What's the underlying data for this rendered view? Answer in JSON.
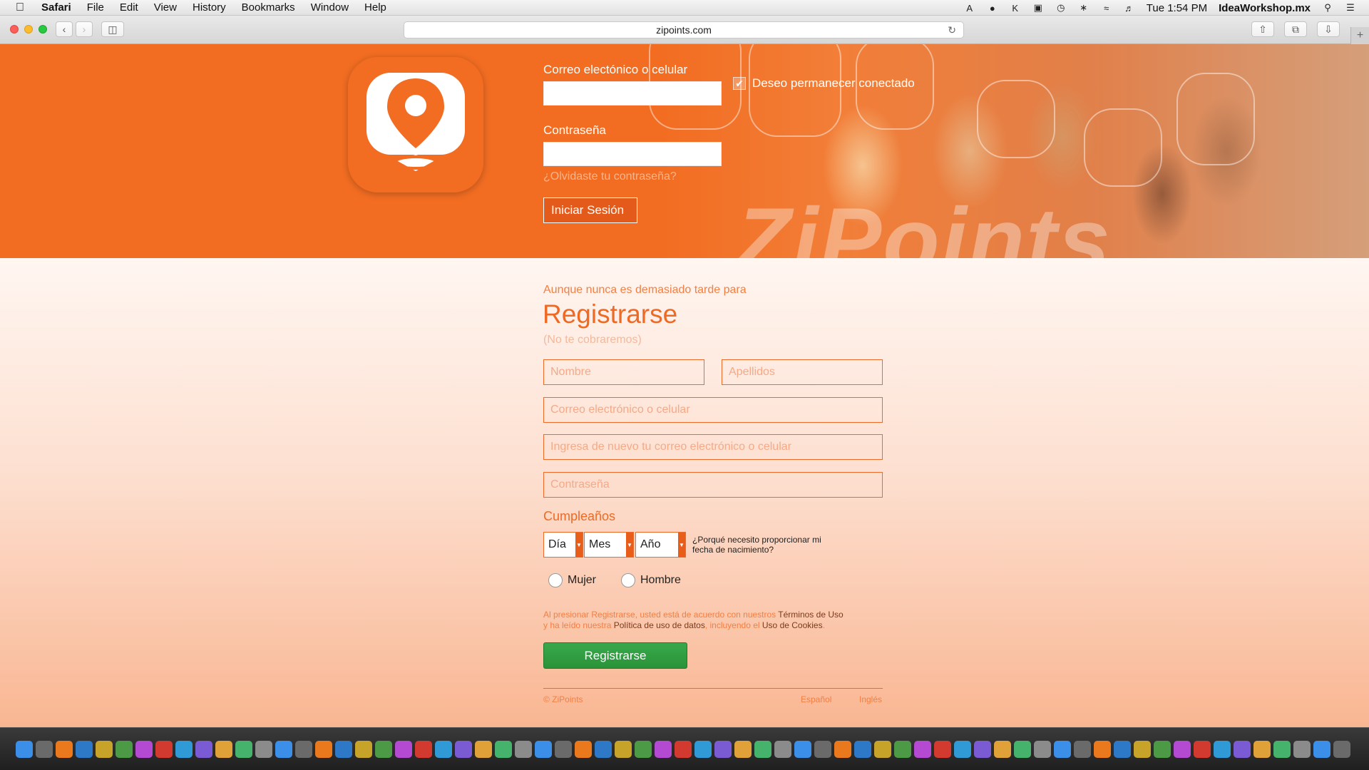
{
  "menubar": {
    "app": "Safari",
    "menus": [
      "File",
      "Edit",
      "View",
      "History",
      "Bookmarks",
      "Window",
      "Help"
    ],
    "clock": "Tue 1:54 PM",
    "user": "IdeaWorkshop.mx"
  },
  "browser": {
    "url": "zipoints.com"
  },
  "login": {
    "email_label": "Correo electónico o celular",
    "password_label": "Contraseña",
    "remember_label": "Deseo permanecer conectado",
    "remember_checked": true,
    "forgot_link": "¿Olvidaste tu contraseña?",
    "submit_label": "Iniciar Sesión",
    "watermark": "ZiPoints"
  },
  "register": {
    "subtitle": "Aunque nunca es demasiado tarde para",
    "title": "Registrarse",
    "note": "(No te cobraremos)",
    "first_name_placeholder": "Nombre",
    "last_name_placeholder": "Apellidos",
    "email_placeholder": "Correo electrónico o celular",
    "email_confirm_placeholder": "Ingresa de nuevo tu correo electrónico o celular",
    "password_placeholder": "Contraseña",
    "birthday_label": "Cumpleaños",
    "day_label": "Día",
    "month_label": "Mes",
    "year_label": "Año",
    "why_text": "¿Porqué necesito proporcionar mi fecha de nacimiento?",
    "gender_female": "Mujer",
    "gender_male": "Hombre",
    "terms_prefix": "Al presionar Registrarse, usted está de acuerdo con nuestros ",
    "terms_link": "Términos de Uso",
    "terms_mid": "y ha leído nuestra ",
    "privacy_link": "Política de uso de datos",
    "terms_mid2": ", incluyendo el ",
    "cookies_link": "Uso de Cookies",
    "terms_end": ".",
    "submit_label": "Registrarse"
  },
  "footer": {
    "copyright": "© ZiPoints",
    "lang_spanish": "Español",
    "lang_english": "Inglés"
  },
  "colors": {
    "brand_orange": "#f26d22",
    "register_green": "#2a9339"
  },
  "dock_icons": [
    "finder-icon",
    "launchpad-icon",
    "illustrator-icon",
    "photoshop-icon",
    "bridge-icon",
    "dreamweaver-icon",
    "fireworks-icon",
    "system-prefs-icon",
    "acrobat-icon",
    "word-icon",
    "powerpoint-icon",
    "excel-icon",
    "app-icon",
    "preview-icon",
    "firefox-icon",
    "safari-icon",
    "opera-icon",
    "chrome-icon",
    "skype-icon",
    "twitter-icon",
    "messages-icon",
    "app-icon",
    "app-icon",
    "app-icon",
    "calendar-icon",
    "notes-icon",
    "app-icon",
    "app-icon",
    "itunes-icon",
    "app-icon",
    "ibooks-icon",
    "app-icon",
    "app-icon",
    "app-icon",
    "app-icon",
    "app-icon",
    "app-icon",
    "app-icon",
    "app-icon",
    "app-icon",
    "app-icon",
    "app-icon",
    "acrobat-icon",
    "app-icon",
    "vlc-icon",
    "app-icon",
    "app-icon",
    "app-icon",
    "app-icon",
    "app-icon",
    "app-icon",
    "app-icon",
    "app-icon",
    "app-icon",
    "app-icon",
    "app-icon",
    "app-icon",
    "app-icon",
    "app-icon",
    "app-icon",
    "app-icon",
    "app-icon",
    "app-icon",
    "app-icon",
    "folder-icon",
    "app-icon",
    "trash-icon"
  ]
}
